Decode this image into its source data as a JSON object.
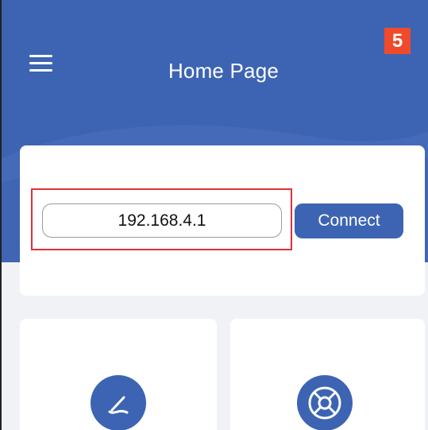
{
  "header": {
    "title": "Home Page",
    "badge": "5",
    "menu_icon": "hamburger-menu-icon"
  },
  "connection": {
    "ip_value": "192.168.4.1",
    "connect_label": "Connect"
  },
  "feature_cards": [
    {
      "icon": "line-tracking-icon"
    },
    {
      "icon": "steering-wheel-icon"
    }
  ],
  "colors": {
    "primary": "#3d64b3",
    "badge": "#ef4a2b",
    "highlight": "#e0303a",
    "background": "#f1f2f6",
    "card": "#ffffff"
  }
}
